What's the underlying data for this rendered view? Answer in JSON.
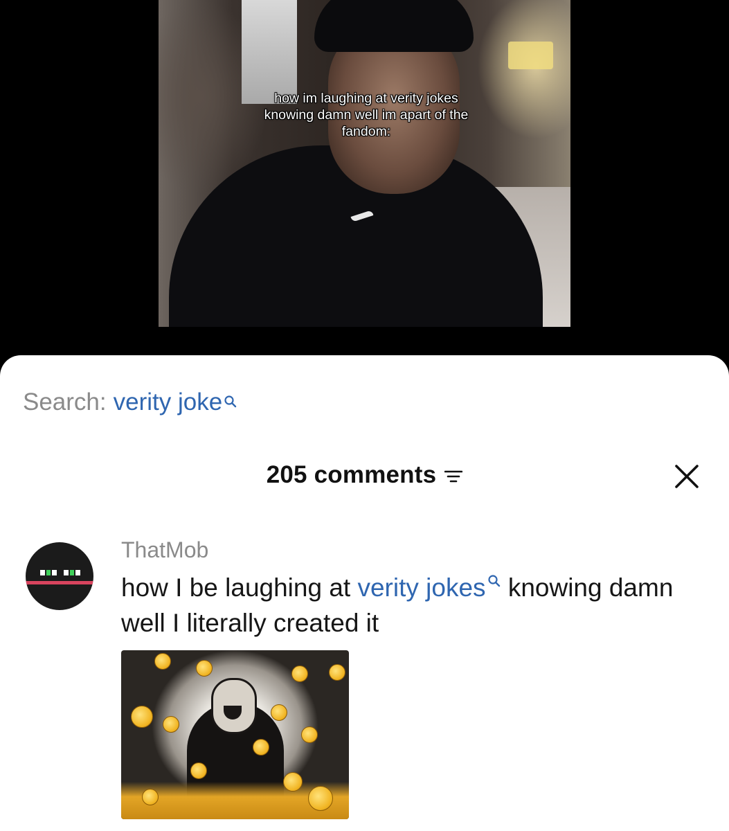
{
  "video": {
    "caption": "how im laughing at verity jokes knowing damn well im apart of the fandom:"
  },
  "search": {
    "label": "Search:",
    "term": "verity joke",
    "icon": "search-icon",
    "term_color": "#2f66b0"
  },
  "comments": {
    "count_label": "205 comments",
    "sort_icon": "sort-icon",
    "close_icon": "close-icon"
  },
  "comment": {
    "username": "ThatMob",
    "text_before": "how I be laughing at ",
    "link_text": "verity jokes",
    "text_after": " knowing damn well I literally created it",
    "link_icon": "search-icon",
    "avatar_colors": {
      "background": "#1b1b1b",
      "stripe": "#d8445e",
      "eyes": "#3fd15a"
    }
  }
}
